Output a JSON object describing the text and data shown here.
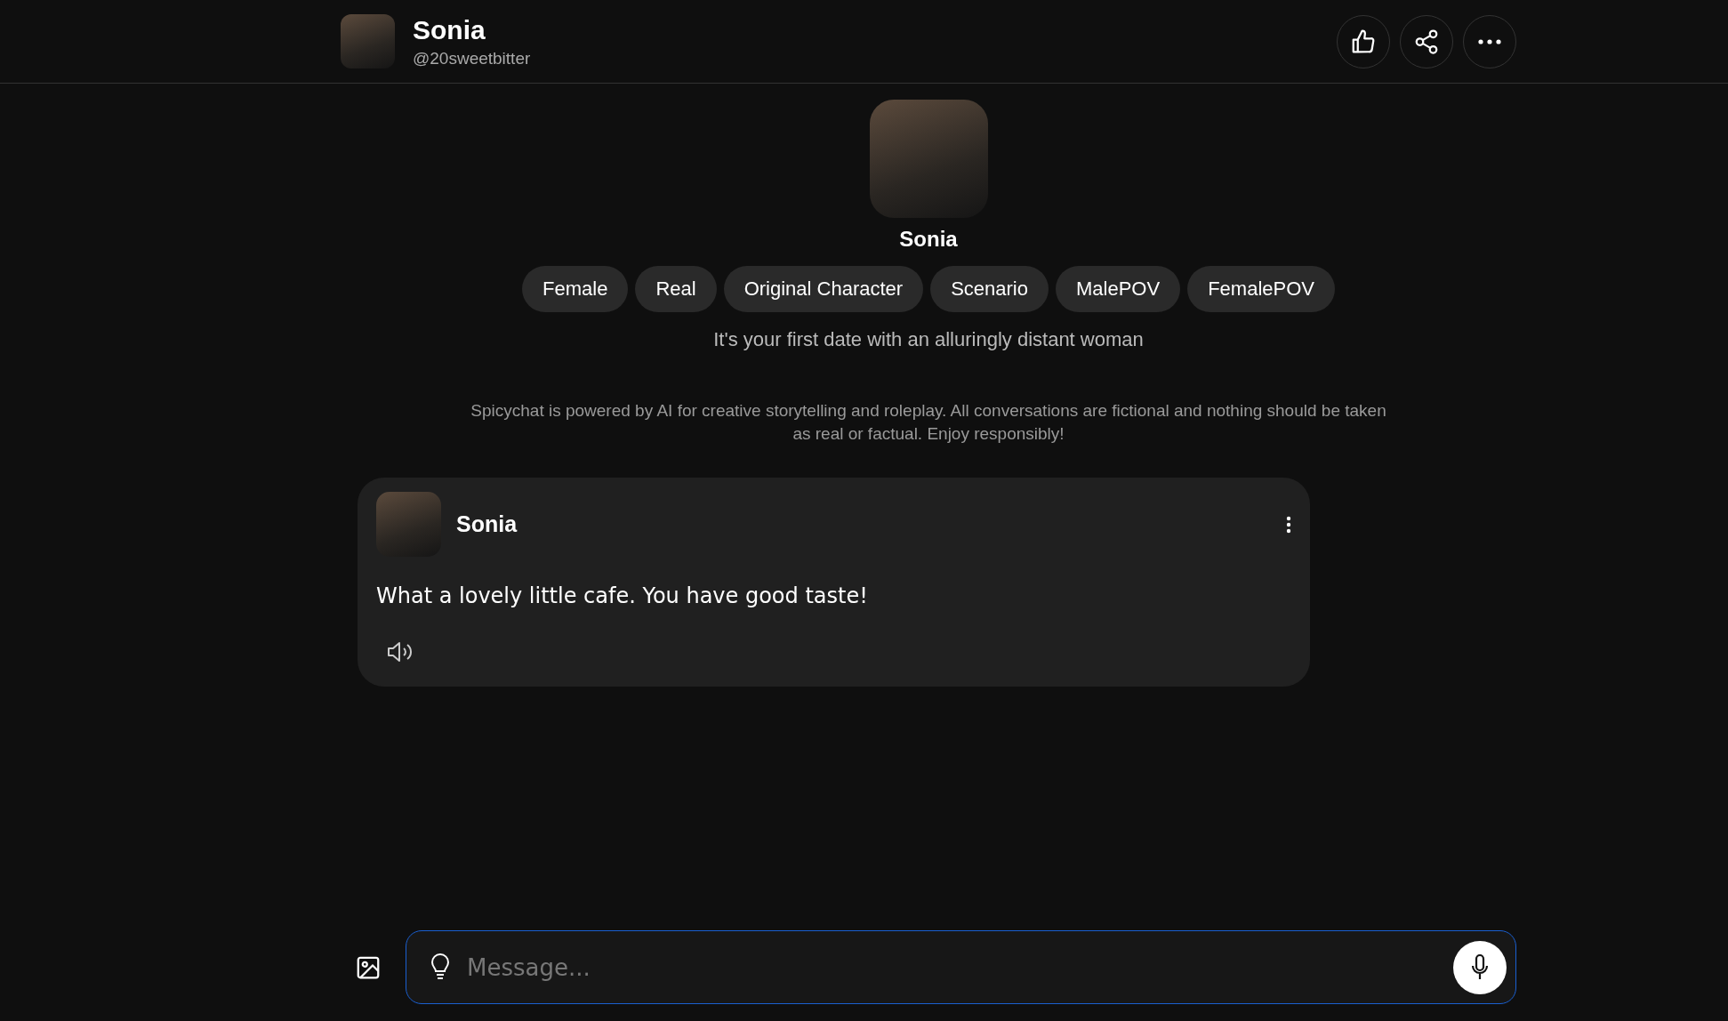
{
  "header": {
    "name": "Sonia",
    "handle": "@20sweetbitter"
  },
  "profile": {
    "name": "Sonia",
    "tags": [
      "Female",
      "Real",
      "Original Character",
      "Scenario",
      "MalePOV",
      "FemalePOV"
    ],
    "tagline": "It's your first date with an alluringly distant woman"
  },
  "disclaimer": "Spicychat is powered by AI for creative storytelling and roleplay. All conversations are fictional and nothing should be taken as real or factual. Enjoy responsibly!",
  "messages": [
    {
      "sender": "Sonia",
      "text": "What a lovely little cafe. You have good taste!"
    }
  ],
  "composer": {
    "placeholder": "Message..."
  }
}
